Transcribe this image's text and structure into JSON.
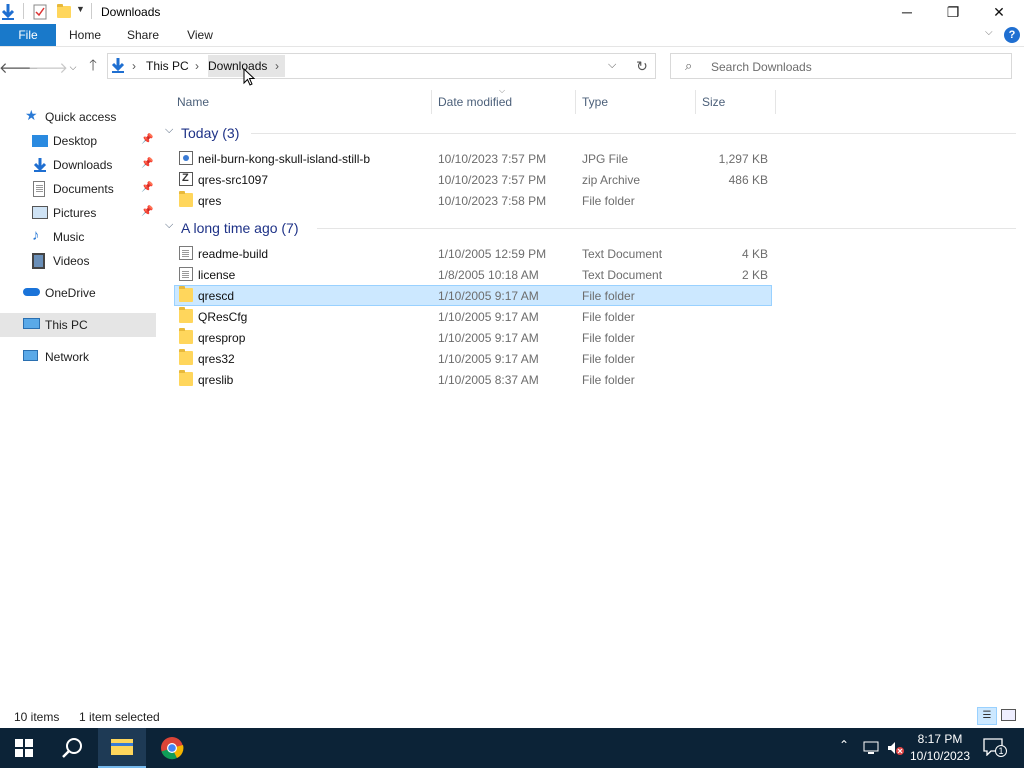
{
  "window": {
    "title": "Downloads",
    "minimize_glyph": "─",
    "restore_glyph": "❐",
    "close_glyph": "✕"
  },
  "ribbon": {
    "tabs": [
      "File",
      "Home",
      "Share",
      "View"
    ],
    "help_glyph": "?"
  },
  "address": {
    "crumbs": [
      "This PC",
      "Downloads"
    ],
    "search_placeholder": "Search Downloads"
  },
  "nav": {
    "quick_access": "Quick access",
    "items": [
      {
        "label": "Desktop",
        "icon": "desktop-icon",
        "pinned": true
      },
      {
        "label": "Downloads",
        "icon": "downloads-icon",
        "pinned": true
      },
      {
        "label": "Documents",
        "icon": "documents-icon",
        "pinned": true
      },
      {
        "label": "Pictures",
        "icon": "pictures-icon",
        "pinned": true
      },
      {
        "label": "Music",
        "icon": "music-icon",
        "pinned": false
      },
      {
        "label": "Videos",
        "icon": "videos-icon",
        "pinned": false
      }
    ],
    "onedrive": "OneDrive",
    "thispc": "This PC",
    "network": "Network"
  },
  "columns": {
    "name": "Name",
    "date": "Date modified",
    "type": "Type",
    "size": "Size"
  },
  "groups": [
    {
      "label": "Today (3)",
      "files": [
        {
          "name": "neil-burn-kong-skull-island-still-b",
          "date": "10/10/2023 7:57 PM",
          "type": "JPG File",
          "size": "1,297 KB",
          "icon": "img"
        },
        {
          "name": "qres-src1097",
          "date": "10/10/2023 7:57 PM",
          "type": "zip Archive",
          "size": "486 KB",
          "icon": "zip"
        },
        {
          "name": "qres",
          "date": "10/10/2023 7:58 PM",
          "type": "File folder",
          "size": "",
          "icon": "folder"
        }
      ]
    },
    {
      "label": "A long time ago (7)",
      "files": [
        {
          "name": "readme-build",
          "date": "1/10/2005 12:59 PM",
          "type": "Text Document",
          "size": "4 KB",
          "icon": "doc"
        },
        {
          "name": "license",
          "date": "1/8/2005 10:18 AM",
          "type": "Text Document",
          "size": "2 KB",
          "icon": "doc"
        },
        {
          "name": "qrescd",
          "date": "1/10/2005 9:17 AM",
          "type": "File folder",
          "size": "",
          "icon": "folder",
          "selected": true
        },
        {
          "name": "QResCfg",
          "date": "1/10/2005 9:17 AM",
          "type": "File folder",
          "size": "",
          "icon": "folder"
        },
        {
          "name": "qresprop",
          "date": "1/10/2005 9:17 AM",
          "type": "File folder",
          "size": "",
          "icon": "folder"
        },
        {
          "name": "qres32",
          "date": "1/10/2005 9:17 AM",
          "type": "File folder",
          "size": "",
          "icon": "folder"
        },
        {
          "name": "qreslib",
          "date": "1/10/2005 8:37 AM",
          "type": "File folder",
          "size": "",
          "icon": "folder"
        }
      ]
    }
  ],
  "status": {
    "count": "10 items",
    "selection": "1 item selected"
  },
  "taskbar": {
    "time": "8:17 PM",
    "date": "10/10/2023",
    "notification_count": "1"
  },
  "colors": {
    "accent": "#1979ca",
    "selection": "#cce8ff",
    "taskbar": "#0c2337"
  }
}
